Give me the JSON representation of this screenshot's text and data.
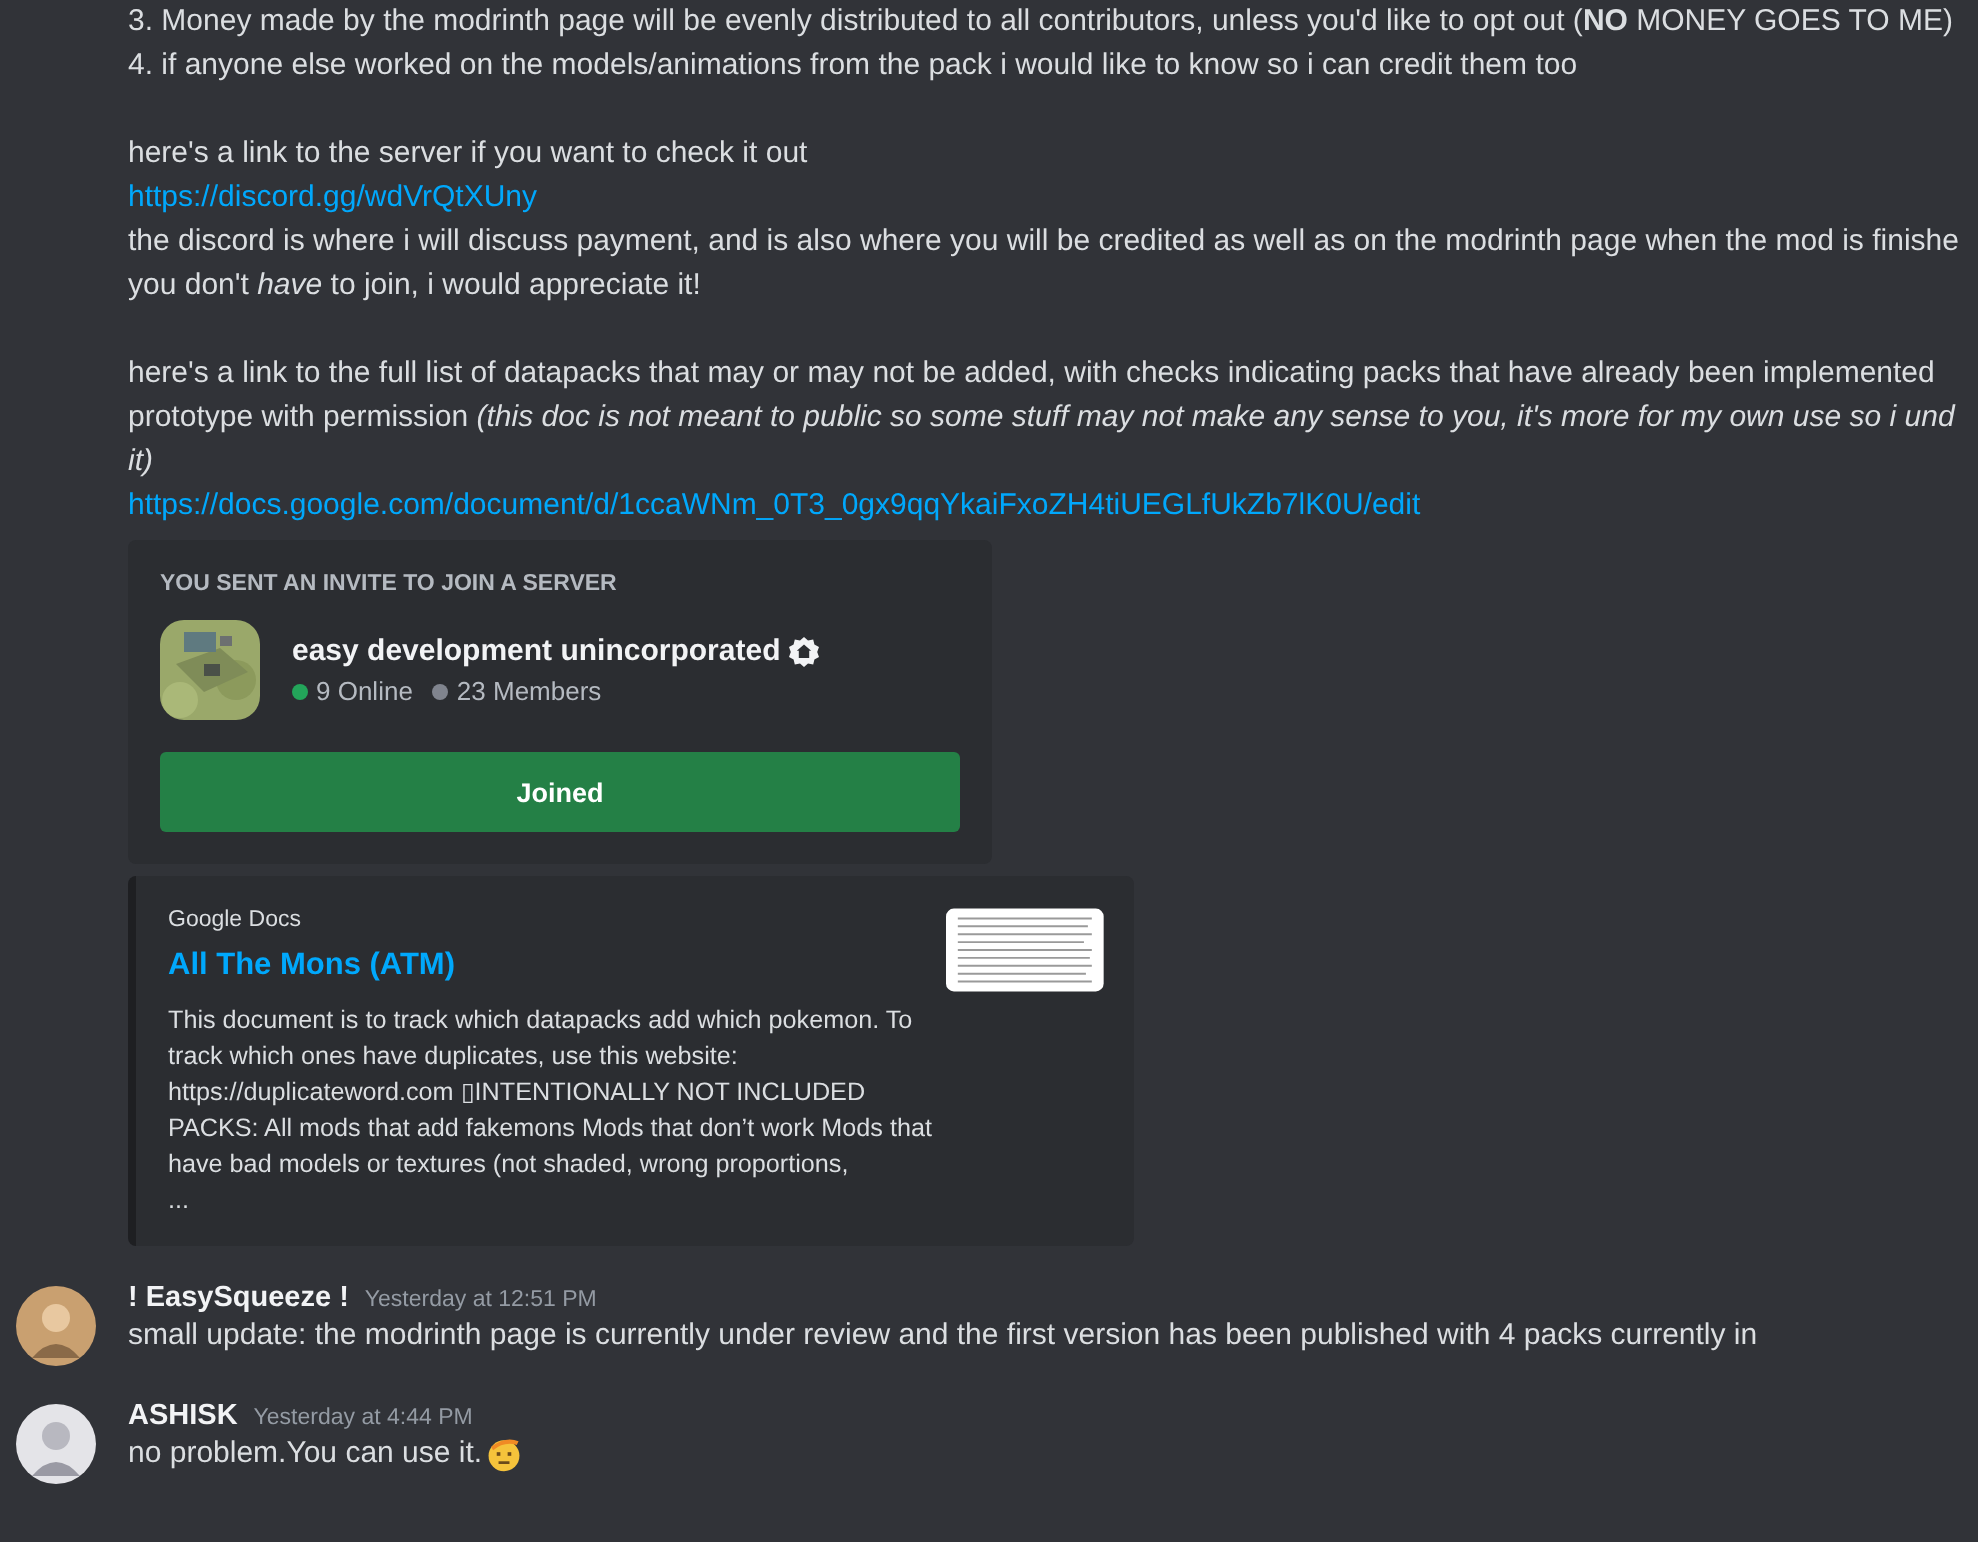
{
  "message_lines": [
    {
      "kind": "text",
      "text": "3. Money made by the modrinth page will be evenly distributed to all contributors, unless you'd like to opt out (**NO** MONEY GOES TO ME)"
    },
    {
      "kind": "text",
      "text": "4. if anyone else worked on the models/animations from the pack i would like to know so i can credit them too"
    },
    {
      "kind": "blank"
    },
    {
      "kind": "text",
      "text": "here's a link to the server if you want to check it out"
    },
    {
      "kind": "link",
      "text": "https://discord.gg/wdVrQtXUny"
    },
    {
      "kind": "text",
      "text": "the discord is where i will discuss payment, and is also where you will be credited as well as on the modrinth page when the mod is finishe"
    },
    {
      "kind": "text",
      "text": "you don't *have* to join, i would appreciate it!"
    },
    {
      "kind": "blank"
    },
    {
      "kind": "text",
      "text": "here's a link to the full list of datapacks that may or may not be added, with checks indicating packs that have already been implemented"
    },
    {
      "kind": "text",
      "text": "prototype with permission *(this doc is not meant to public so some stuff may not make any sense to you, it's more for my own use so i und*"
    },
    {
      "kind": "text",
      "text": "*it)*"
    },
    {
      "kind": "link",
      "text": "https://docs.google.com/document/d/1ccaWNm_0T3_0gx9qqYkaiFxoZH4tiUEGLfUkZb7lK0U/edit"
    }
  ],
  "invite": {
    "heading": "YOU SENT AN INVITE TO JOIN A SERVER",
    "server_name": "easy development unincorporated",
    "stats": [
      {
        "text": "9 Online",
        "color": "#23a55a"
      },
      {
        "text": "23 Members",
        "color": "#80848e"
      }
    ],
    "button": "Joined"
  },
  "doc_embed": {
    "provider": "Google Docs",
    "title": "All The Mons (ATM)",
    "description": "This document is to track which datapacks add which pokemon. To track which ones have duplicates, use this website: https://duplicateword.com ▯INTENTIONALLY NOT INCLUDED PACKS: All mods that add fakemons Mods that don’t work Mods that have bad models or textures (not shaded, wrong proportions,",
    "ellipsis": "..."
  },
  "messages": [
    {
      "author": "! EasySqueeze !",
      "time": "Yesterday at 12:51 PM",
      "text": "small update: the modrinth page is currently under review and the first version has been published with 4 packs currently in",
      "emoji": false
    },
    {
      "author": "ASHISK",
      "time": "Yesterday at 4:44 PM",
      "text": "no problem.You can use it.",
      "emoji": true
    }
  ]
}
